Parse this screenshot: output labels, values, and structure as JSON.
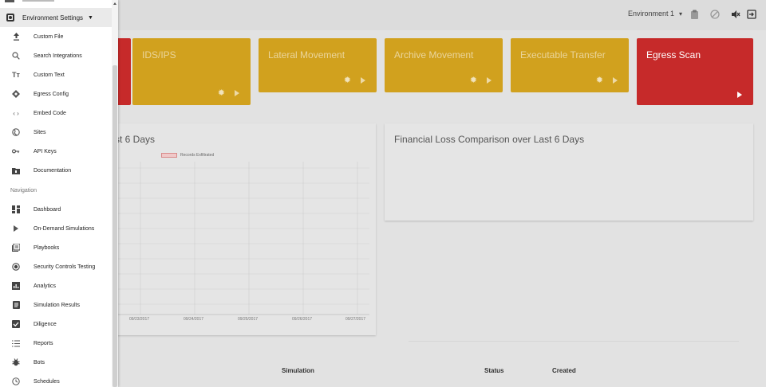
{
  "topbar": {
    "environment_label": "Environment 1",
    "icons": [
      "clipboard-icon",
      "block-icon",
      "mute-icon",
      "logout-icon"
    ]
  },
  "tiles": [
    {
      "label": "IDS/IPS",
      "color": "#d1a11e"
    },
    {
      "label": "Lateral Movement",
      "color": "#d1a11e"
    },
    {
      "label": "Archive Movement",
      "color": "#d1a11e"
    },
    {
      "label": "Executable Transfer",
      "color": "#d1a11e"
    },
    {
      "label": "Egress Scan",
      "color": "#c62a2a"
    }
  ],
  "chart_card": {
    "title_visible": "st 6 Days",
    "legend": "Records Exfiltrated",
    "x_ticks": [
      "09/23/2017",
      "09/24/2017",
      "09/25/2017",
      "09/26/2017",
      "09/27/2017"
    ]
  },
  "loss_card": {
    "title": "Financial Loss Comparison over Last 6 Days"
  },
  "table": {
    "headers": [
      "Simulation",
      "Status",
      "Created"
    ]
  },
  "sidebar": {
    "header": "Environment Settings",
    "items": [
      {
        "label": "Custom File",
        "icon": "upload-icon"
      },
      {
        "label": "Search Integrations",
        "icon": "search-icon"
      },
      {
        "label": "Custom Text",
        "icon": "text-icon"
      },
      {
        "label": "Egress Config",
        "icon": "diamond-icon"
      },
      {
        "label": "Embed Code",
        "icon": "code-icon"
      },
      {
        "label": "Sites",
        "icon": "globe-icon"
      },
      {
        "label": "API Keys",
        "icon": "key-icon"
      },
      {
        "label": "Documentation",
        "icon": "folder-icon"
      }
    ],
    "section_label": "Navigation",
    "nav_items": [
      {
        "label": "Dashboard",
        "icon": "dashboard-icon"
      },
      {
        "label": "On-Demand Simulations",
        "icon": "play-icon"
      },
      {
        "label": "Playbooks",
        "icon": "playbook-icon"
      },
      {
        "label": "Security Controls Testing",
        "icon": "radio-icon"
      },
      {
        "label": "Analytics",
        "icon": "analytics-icon"
      },
      {
        "label": "Simulation Results",
        "icon": "document-icon"
      },
      {
        "label": "Diligence",
        "icon": "check-icon"
      },
      {
        "label": "Reports",
        "icon": "list-icon"
      },
      {
        "label": "Bots",
        "icon": "bug-icon"
      },
      {
        "label": "Schedules",
        "icon": "clock-icon"
      }
    ]
  }
}
